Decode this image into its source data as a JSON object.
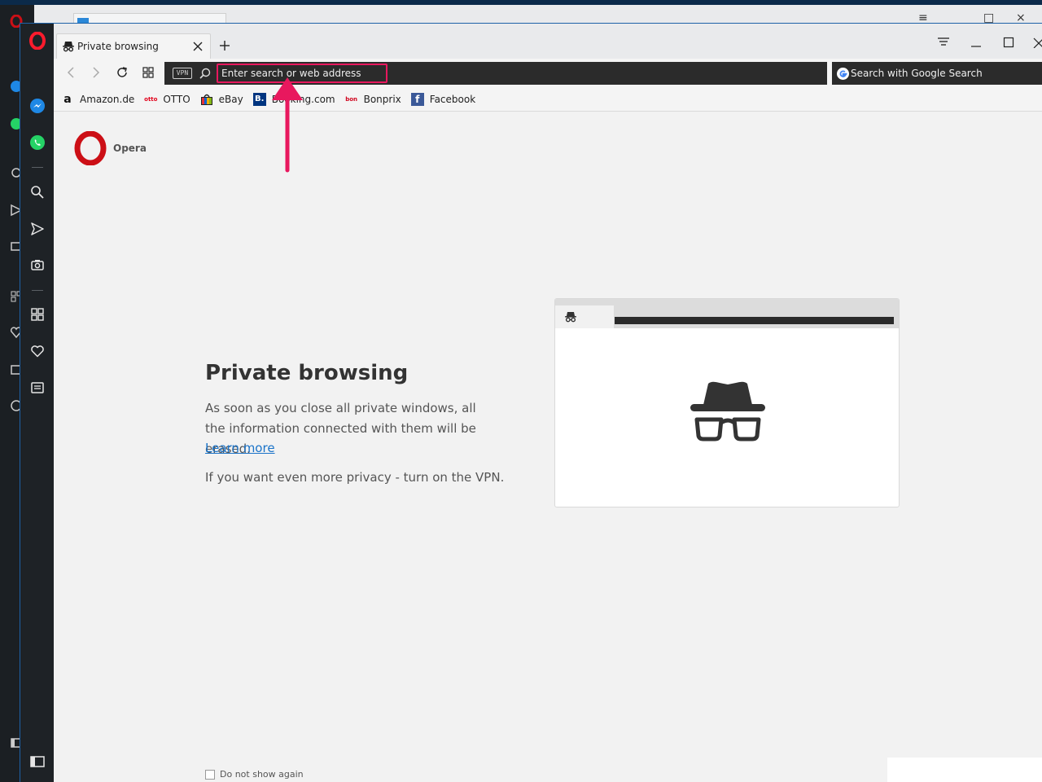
{
  "window": {
    "tab_title": "Private browsing",
    "new_tab_symbol": "+"
  },
  "toolbar": {
    "vpn_label": "VPN",
    "address_placeholder": "Enter search or web address",
    "search_engine_label": "Search with Google Search"
  },
  "bookmarks": [
    {
      "label": "Amazon.de",
      "icon": "amazon-icon",
      "glyph": "a"
    },
    {
      "label": "OTTO",
      "icon": "otto-icon",
      "glyph": "otto"
    },
    {
      "label": "eBay",
      "icon": "ebay-icon",
      "glyph": ""
    },
    {
      "label": "Booking.com",
      "icon": "booking-icon",
      "glyph": "B."
    },
    {
      "label": "Bonprix",
      "icon": "bonprix-icon",
      "glyph": "bon"
    },
    {
      "label": "Facebook",
      "icon": "facebook-icon",
      "glyph": "f"
    }
  ],
  "page": {
    "brand": "Opera",
    "heading": "Private browsing",
    "description": "As soon as you close all private windows, all the information connected with them will be erased.",
    "learn_more": "Learn more",
    "vpn_tip": "If you want even more privacy - turn on the VPN.",
    "dont_show_again": "Do not show again"
  },
  "colors": {
    "accent_highlight": "#e8185e",
    "opera_red": "#cc0f16",
    "link": "#1a73c9",
    "sidebar_bg": "#1e2226",
    "address_bg": "#2b2b2b"
  },
  "sidebar": {
    "items": [
      "messenger-icon",
      "whatsapp-icon",
      "search-icon",
      "send-icon",
      "camera-icon",
      "speed-dial-icon",
      "heart-icon",
      "news-icon",
      "sidebar-toggle-icon"
    ]
  }
}
